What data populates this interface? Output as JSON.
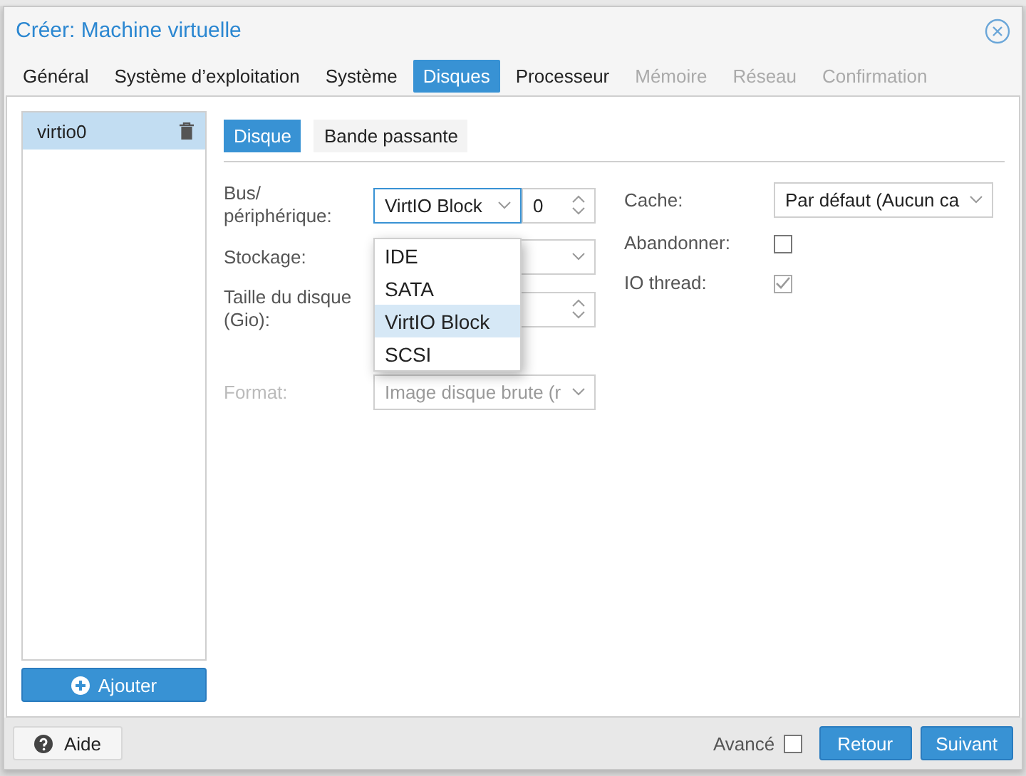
{
  "window": {
    "title": "Créer: Machine virtuelle"
  },
  "tabs": [
    {
      "label": "Général",
      "selected": false,
      "disabled": false
    },
    {
      "label": "Système d’exploitation",
      "selected": false,
      "disabled": false
    },
    {
      "label": "Système",
      "selected": false,
      "disabled": false
    },
    {
      "label": "Disques",
      "selected": true,
      "disabled": false
    },
    {
      "label": "Processeur",
      "selected": false,
      "disabled": false
    },
    {
      "label": "Mémoire",
      "selected": false,
      "disabled": true
    },
    {
      "label": "Réseau",
      "selected": false,
      "disabled": true
    },
    {
      "label": "Confirmation",
      "selected": false,
      "disabled": true
    }
  ],
  "disk_list": {
    "items": [
      {
        "label": "virtio0",
        "selected": true
      }
    ],
    "add_button": "Ajouter"
  },
  "subtabs": [
    {
      "label": "Disque",
      "selected": true
    },
    {
      "label": "Bande passante",
      "selected": false
    }
  ],
  "form": {
    "bus": {
      "label": "Bus/ périphérique:",
      "value": "VirtIO Block",
      "index": "0"
    },
    "bus_options": [
      {
        "label": "IDE",
        "selected": false
      },
      {
        "label": "SATA",
        "selected": false
      },
      {
        "label": "VirtIO Block",
        "selected": true
      },
      {
        "label": "SCSI",
        "selected": false
      }
    ],
    "storage": {
      "label": "Stockage:"
    },
    "size": {
      "label": "Taille du disque (Gio):"
    },
    "format": {
      "label": "Format:",
      "value": "Image disque brute (r",
      "disabled": true
    },
    "cache": {
      "label": "Cache:",
      "value": "Par défaut (Aucun ca"
    },
    "discard": {
      "label": "Abandonner:",
      "checked": false,
      "disabled": false
    },
    "io_thread": {
      "label": "IO thread:",
      "checked": true,
      "disabled": true
    }
  },
  "footer": {
    "help": "Aide",
    "advanced": {
      "label": "Avancé",
      "checked": false
    },
    "back": "Retour",
    "next": "Suivant"
  }
}
